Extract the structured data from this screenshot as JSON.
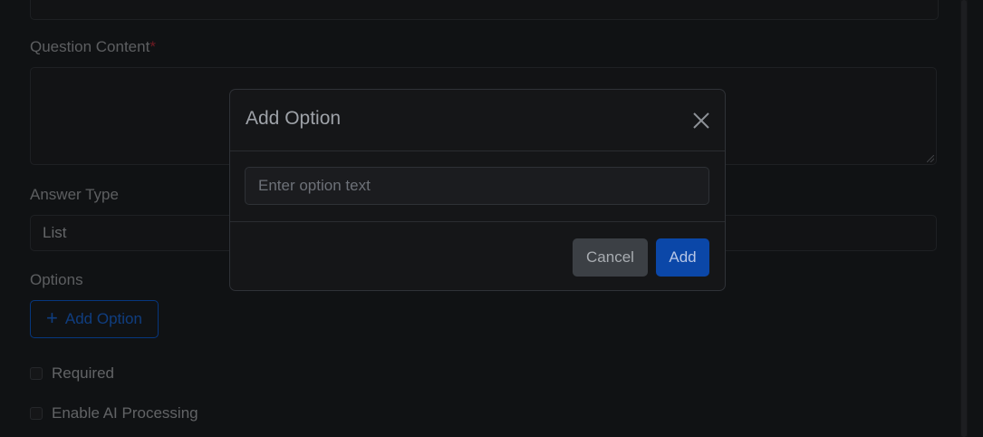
{
  "form": {
    "question_content_label": "Question Content",
    "required_marker": "*",
    "answer_type_label": "Answer Type",
    "answer_type_value": "List",
    "options_label": "Options",
    "add_option_label": "Add Option",
    "required_checkbox_label": "Required",
    "ai_processing_checkbox_label": "Enable AI Processing"
  },
  "modal": {
    "title": "Add Option",
    "input_placeholder": "Enter option text",
    "input_value": "",
    "cancel_label": "Cancel",
    "add_label": "Add"
  },
  "icons": {
    "close": "close-icon",
    "plus": "plus-icon"
  },
  "colors": {
    "primary": "#0d6efd",
    "required": "#dc3545"
  }
}
